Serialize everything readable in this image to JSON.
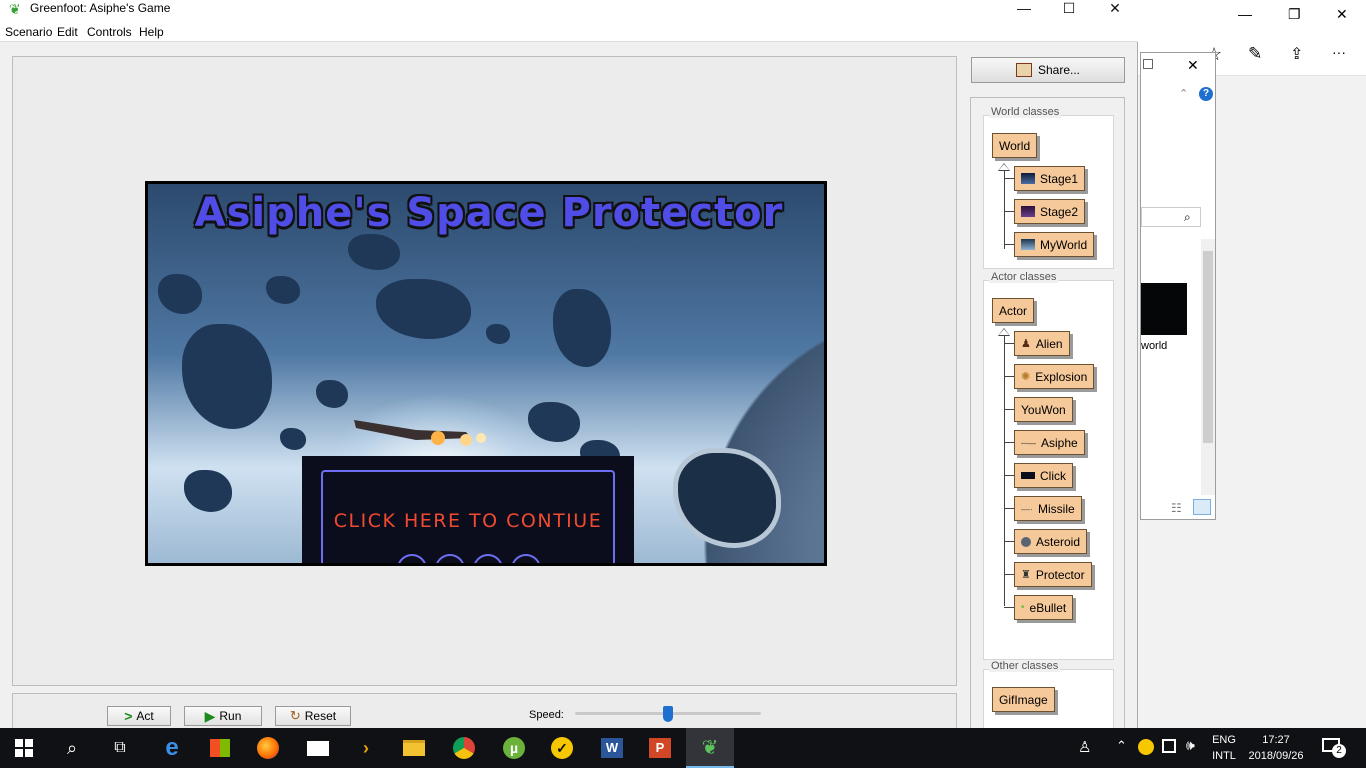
{
  "window": {
    "title": "Greenfoot: Asiphe's Game",
    "minimize": "—",
    "maximize": "☐",
    "close": "✕"
  },
  "menu": [
    "Scenario",
    "Edit",
    "Controls",
    "Help"
  ],
  "share_label": "Share...",
  "world": {
    "title": "Asiphe's Space Protector",
    "continue_text": "CLICK HERE TO CONTIUE"
  },
  "controls": {
    "act_label": "Act",
    "run_label": "Run",
    "reset_label": "Reset",
    "speed_label": "Speed:",
    "speed_level": 0.5
  },
  "class_panel": {
    "world_label": "World classes",
    "world_root": "World",
    "world_subclasses": [
      "Stage1",
      "Stage2",
      "MyWorld"
    ],
    "actor_label": "Actor classes",
    "actor_root": "Actor",
    "actor_subclasses": [
      "Alien",
      "Explosion",
      "YouWon",
      "Asiphe",
      "Click",
      "Missile",
      "Asteroid",
      "Protector",
      "eBullet"
    ],
    "other_label": "Other classes",
    "other_classes": [
      "GifImage"
    ]
  },
  "background_window": {
    "minimize": "—",
    "restore": "❐",
    "close": "✕",
    "more": "···",
    "thumb_label": "world",
    "dialog_close": "✕",
    "help": "?"
  },
  "taskbar": {
    "lang_line1": "ENG",
    "lang_line2": "INTL",
    "time": "17:27",
    "date": "2018/09/26",
    "notifications": "2"
  },
  "colors": {
    "class_fill": "#f5c99a",
    "accent": "#1e6fd0",
    "title_blue": "#4f4de6",
    "continue_red": "#f04a30"
  }
}
